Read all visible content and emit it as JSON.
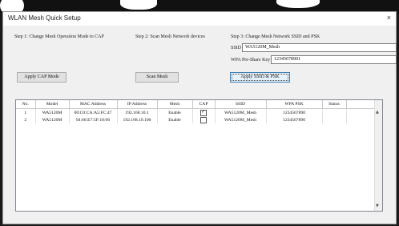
{
  "window": {
    "title": "WLAN Mesh Quick Setup",
    "close_glyph": "×"
  },
  "steps": {
    "step1": "Step 1: Change Mesh Operation Mode to CAP",
    "step2": "Step 2: Scan Mesh Network devices",
    "step3": "Step 3: Change Mesh Network SSID and PSK"
  },
  "form": {
    "ssid_label": "SSID",
    "ssid_value": "WA5120M_Mesh",
    "psk_label": "WPA Pre-Share Key",
    "psk_value": "1234567890​1"
  },
  "buttons": {
    "apply_cap": "Apply CAP Mode",
    "scan": "Scan Mesh",
    "apply_ssid": "Apply SSID & PSK"
  },
  "table": {
    "columns": [
      "No.",
      "Model",
      "MAC Address",
      "IP Address",
      "Mesh",
      "CAP",
      "SSID",
      "WPA PSK",
      "Status"
    ],
    "rows": [
      {
        "no": "1",
        "model": "WA5120M",
        "mac": "00:C0:CA:A5:FC:47",
        "ip": "192.168.10.1",
        "mesh": "Enable",
        "cap_checked": true,
        "ssid": "WA5120M_Mesh",
        "psk": "1234567890",
        "status": ""
      },
      {
        "no": "2",
        "model": "WA5120M",
        "mac": "94:66:E7:5F:10:06",
        "ip": "192.168.10.100",
        "mesh": "Enable",
        "cap_checked": false,
        "ssid": "WA5120M_Mesh",
        "psk": "1234567890",
        "status": ""
      }
    ]
  },
  "icons": {
    "scroll_up": "up-arrow-icon",
    "scroll_down": "down-arrow-icon",
    "close": "close-icon"
  },
  "colors": {
    "window_bg": "#f0f0f0",
    "focus_border": "#3c7fb1",
    "grid_border": "#828790"
  }
}
